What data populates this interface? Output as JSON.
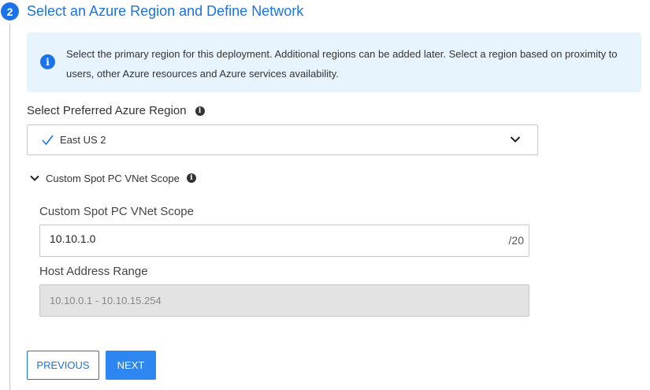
{
  "step": {
    "number": "2",
    "title": "Select an Azure Region and Define Network"
  },
  "info": {
    "icon": "info-icon",
    "text": "Select the primary region for this deployment. Additional regions can be added later. Select a region based on proximity to users, other Azure resources and Azure services availability."
  },
  "region": {
    "label": "Select Preferred Azure Region",
    "selected": "East US 2"
  },
  "scope_section": {
    "toggle_label": "Custom Spot PC VNet Scope",
    "expanded": true,
    "vnet_label": "Custom Spot PC VNet Scope",
    "vnet_value": "10.10.1.0",
    "vnet_suffix": "/20",
    "host_label": "Host Address Range",
    "host_value": "10.10.0.1 - 10.10.15.254"
  },
  "buttons": {
    "previous": "PREVIOUS",
    "next": "NEXT"
  },
  "colors": {
    "accent": "#1a73e8",
    "info_bg": "#e8f4fd",
    "disabled_bg": "#e3e3e3"
  }
}
